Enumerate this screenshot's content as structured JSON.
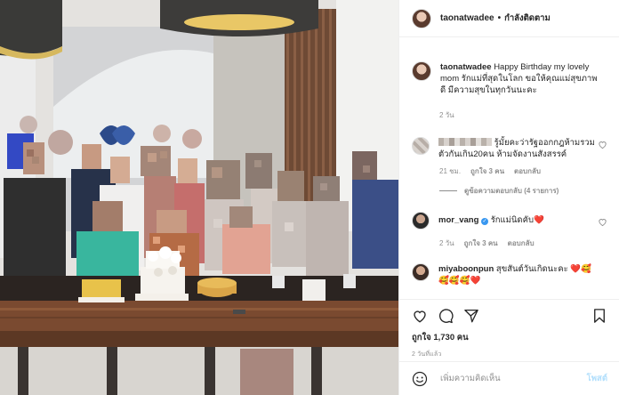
{
  "post_header": {
    "username": "taonatwadee",
    "separator": "•",
    "follow_status": "กำลังติดตาม"
  },
  "caption": {
    "username": "taonatwadee",
    "text": "Happy Birthday my lovely mom รักแม่ที่สุดในโลก ขอให้คุณแม่สุขภาพดี มีความสุขในทุกวันนะคะ",
    "age": "2 วัน"
  },
  "comments": [
    {
      "username_blurred": true,
      "text": "รู้มั้ยคะว่ารัฐออกกฎห้ามรวมตัวกันเกิน20คน ห้ามจัดงานสังสรรค์",
      "age": "21 ชม.",
      "likes": "ถูกใจ 3 คน",
      "reply": "ตอบกลับ",
      "view_replies": "ดูข้อความตอบกลับ (4 รายการ)"
    },
    {
      "username": "mor_vang",
      "verified": true,
      "text": "รักแม่นิดคับ❤️",
      "age": "2 วัน",
      "likes": "ถูกใจ 3 คน",
      "reply": "ตอบกลับ"
    },
    {
      "username": "miyaboonpun",
      "text": "สุขสันต์วันเกิดนะคะ ❤️🥰🥰🥰🥰❤️"
    }
  ],
  "actions": {
    "likes": "ถูกใจ 1,730 คน",
    "date": "2 วันที่แล้ว"
  },
  "composer": {
    "placeholder": "เพิ่มความคิดเห็น",
    "post_label": "โพสต์"
  },
  "colors": {
    "link_blue_disabled": "#b2dffc",
    "verified": "#3897f0",
    "muted": "#8e8e8e",
    "heart": "#ed4956"
  }
}
